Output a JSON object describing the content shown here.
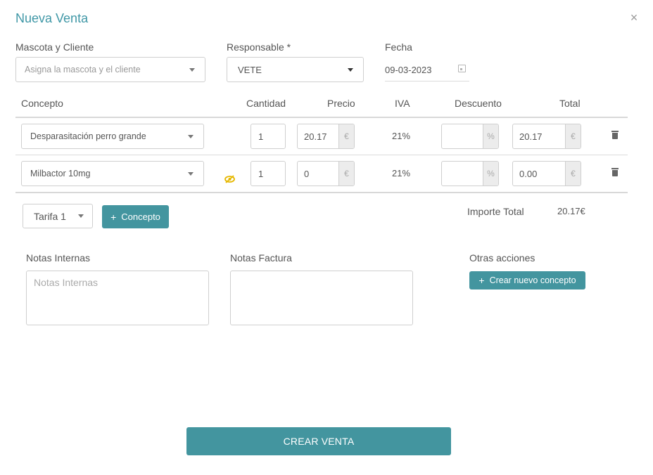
{
  "header": {
    "title": "Nueva Venta",
    "close_symbol": "×"
  },
  "form": {
    "mascota_label": "Mascota y Cliente",
    "mascota_placeholder": "Asigna la mascota y el cliente",
    "responsable_label": "Responsable *",
    "responsable_value": "VETE",
    "fecha_label": "Fecha",
    "fecha_value": "09-03-2023"
  },
  "table": {
    "headers": {
      "concepto": "Concepto",
      "cantidad": "Cantidad",
      "precio": "Precio",
      "iva": "IVA",
      "descuento": "Descuento",
      "total": "Total"
    },
    "rows": [
      {
        "concepto": "Desparasitación perro grande",
        "cantidad": "1",
        "precio": "20.17",
        "precio_unit": "€",
        "iva": "21%",
        "descuento": "",
        "descuento_unit": "%",
        "total": "20.17",
        "total_unit": "€",
        "hidden_icon": false
      },
      {
        "concepto": "Milbactor 10mg",
        "cantidad": "1",
        "precio": "0",
        "precio_unit": "€",
        "iva": "21%",
        "descuento": "",
        "descuento_unit": "%",
        "total": "0.00",
        "total_unit": "€",
        "hidden_icon": true
      }
    ]
  },
  "footer_row": {
    "tarifa_value": "Tarifa 1",
    "add_concepto_plus": "+",
    "add_concepto_label": "Concepto",
    "importe_label": "Importe Total",
    "importe_value": "20.17€"
  },
  "notes": {
    "internas_label": "Notas Internas",
    "internas_placeholder": "Notas Internas",
    "factura_label": "Notas Factura",
    "factura_value": ""
  },
  "otras": {
    "label": "Otras acciones",
    "crear_plus": "+",
    "crear_label": "Crear nuevo concepto"
  },
  "submit": {
    "label": "CREAR VENTA"
  },
  "colors": {
    "accent": "#43959f",
    "title": "#3f97a6",
    "warning_icon": "#e6b800"
  }
}
